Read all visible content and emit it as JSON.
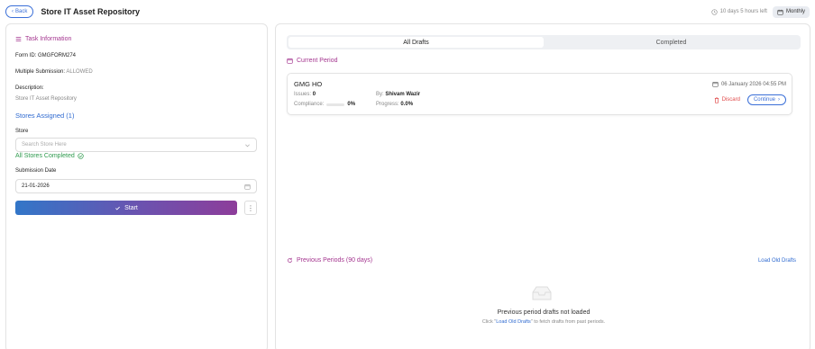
{
  "header": {
    "back_label": "Back",
    "title": "Store IT Asset Repository",
    "time_left": "10 days 5 hours left",
    "frequency": "Monthly"
  },
  "task": {
    "section_title": "Task Information",
    "form_id_label": "Form ID:",
    "form_id_value": "GMGFORM274",
    "multiple_label": "Multiple Submission:",
    "multiple_value": "ALLOWED",
    "description_label": "Description:",
    "description_value": "Store IT Asset Repository",
    "stores_assigned": "Stores Assigned (1)",
    "store_label": "Store",
    "store_placeholder": "Search Store Here",
    "stores_status": "All Stores Completed",
    "date_label": "Submission Date",
    "date_value": "21-01-2026",
    "start_label": "Start"
  },
  "tabs": [
    {
      "label": "All Drafts",
      "active": true
    },
    {
      "label": "Completed",
      "active": false
    }
  ],
  "current": {
    "title": "Current Period",
    "draft": {
      "name": "GMG HO",
      "issues_label": "Issues:",
      "issues_value": "0",
      "by_label": "By:",
      "by_value": "Shivam Wazir",
      "compliance_label": "Compliance:",
      "compliance_value": "0%",
      "compliance_fraction": 0,
      "progress_label": "Progress:",
      "progress_value": "0.0%",
      "date": "06 January 2026 04:55 PM",
      "discard_label": "Discard",
      "continue_label": "Continue"
    }
  },
  "previous": {
    "title": "Previous Periods (90 days)",
    "load_link": "Load Old Drafts",
    "empty_title": "Previous period drafts not loaded",
    "hint_before": "Click \"",
    "hint_link": "Load Old Drafts",
    "hint_after": "\" to fetch drafts from past periods."
  },
  "colors": {
    "accent_purple": "#a4358f",
    "accent_blue": "#2f6ad0",
    "success_green": "#2e9a4d",
    "danger_red": "#e04a4a"
  },
  "icons": [
    "chevron-left-icon",
    "clock-icon",
    "calendar-icon",
    "list-icon",
    "chevron-down-icon",
    "check-circle-icon",
    "check-icon",
    "more-vertical-icon",
    "refresh-icon",
    "trash-icon",
    "chevron-right-icon",
    "inbox-icon"
  ]
}
